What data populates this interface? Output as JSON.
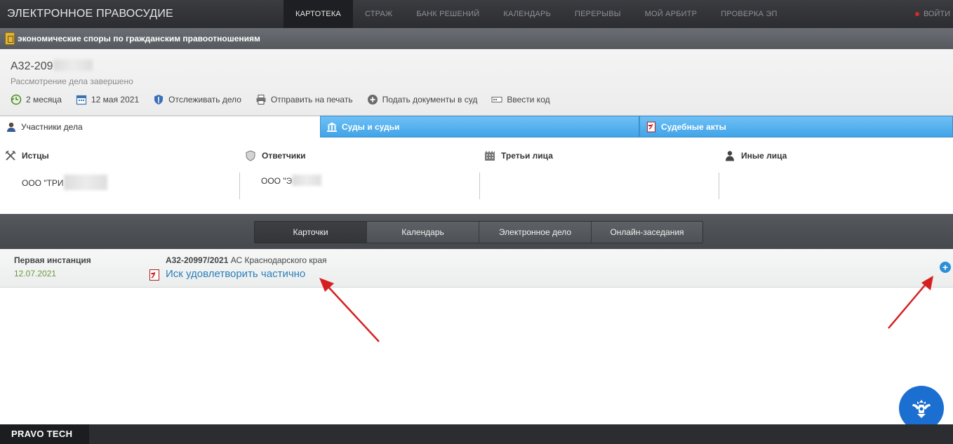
{
  "app": {
    "brand": "ЭЛЕКТРОННОЕ ПРАВОСУДИЕ",
    "nav": [
      "КАРТОТЕКА",
      "СТРАЖ",
      "БАНК РЕШЕНИЙ",
      "КАЛЕНДАРЬ",
      "ПЕРЕРЫВЫ",
      "МОЙ АРБИТР",
      "ПРОВЕРКА ЭП"
    ],
    "active_nav": "КАРТОТЕКА",
    "login_label": "ВОЙТИ"
  },
  "category": {
    "label": "экономические споры по гражданским правоотношениям"
  },
  "case": {
    "number_visible": "А32-209",
    "status": "Рассмотрение дела завершено",
    "actions": [
      {
        "icon": "clock-back-icon",
        "label": "2 месяца"
      },
      {
        "icon": "calendar-icon",
        "label": "12 мая 2021"
      },
      {
        "icon": "shield-icon",
        "label": "Отслеживать дело"
      },
      {
        "icon": "printer-icon",
        "label": "Отправить на печать"
      },
      {
        "icon": "plus-circle-icon",
        "label": "Подать документы в суд"
      },
      {
        "icon": "code-icon",
        "label": "Ввести код"
      }
    ]
  },
  "tabs": {
    "participants": "Участники дела",
    "courts": "Суды и судьи",
    "acts": "Судебные акты"
  },
  "participants": {
    "plaintiffs": {
      "label": "Истцы",
      "value": "ООО \"ТРИ"
    },
    "defendants": {
      "label": "Ответчики",
      "value": "ООО \"Э"
    },
    "third_parties": {
      "label": "Третьи лица",
      "value": ""
    },
    "others": {
      "label": "Иные лица",
      "value": ""
    }
  },
  "subtabs": [
    "Карточки",
    "Календарь",
    "Электронное дело",
    "Онлайн-заседания"
  ],
  "instance": {
    "title": "Первая инстанция",
    "date": "12.07.2021",
    "case_number": "А32-20997/2021",
    "court": "АС Краснодарского края",
    "document_link": "Иск удовлетворить частично",
    "expand_label": "+"
  },
  "footer": {
    "logo": "PRAVO TECH"
  },
  "colors": {
    "accent_blue": "#41a4e8",
    "link_blue": "#2a7fb8",
    "date_green": "#6a9a3a",
    "annotation_red": "#d62020"
  }
}
